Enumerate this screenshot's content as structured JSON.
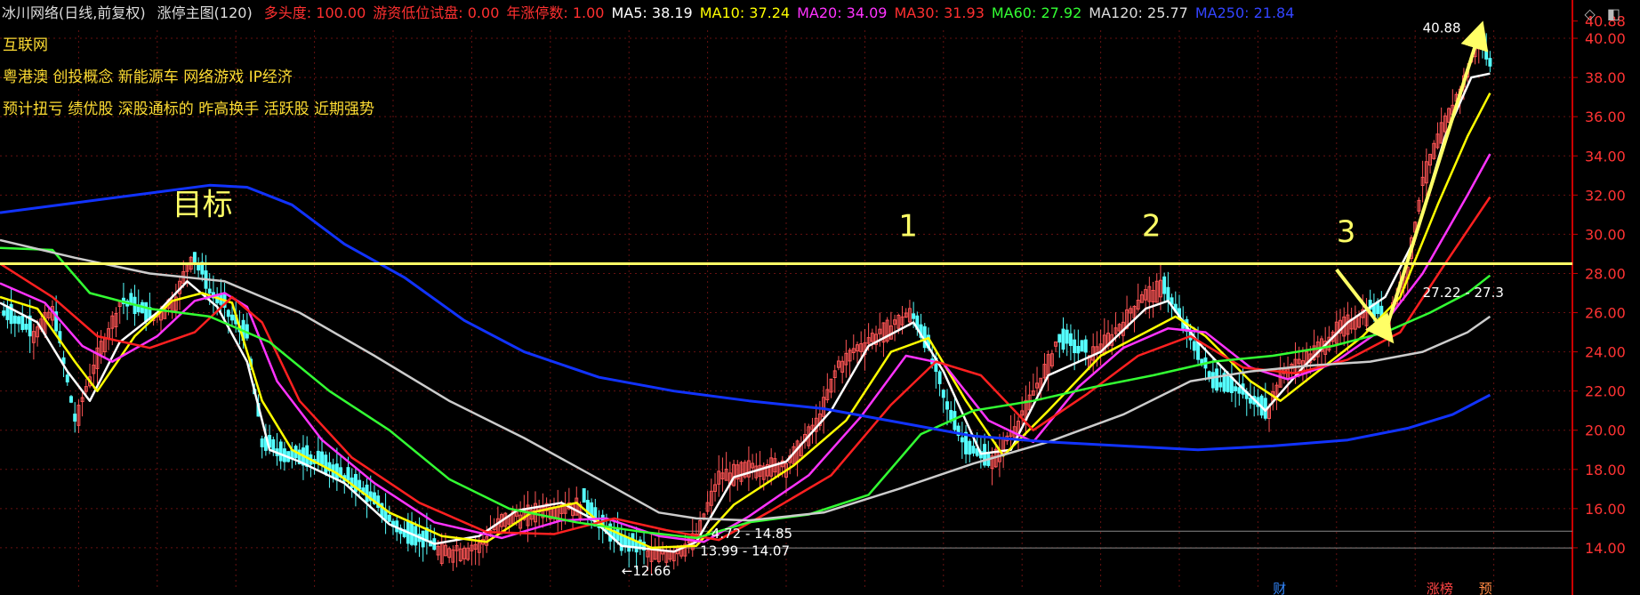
{
  "header": {
    "title": "冰川网络(日线,前复权)",
    "main_chart_label": "涨停主图(120)",
    "indicators": [
      {
        "label": "多头度: 100.00",
        "color": "#ff3030"
      },
      {
        "label": "游资低位试盘: 0.00",
        "color": "#ff3030"
      },
      {
        "label": "年涨停数: 1.00",
        "color": "#ff3030"
      },
      {
        "label": "MA5: 38.19",
        "color": "#ffffff"
      },
      {
        "label": "MA10: 37.24",
        "color": "#ffff00"
      },
      {
        "label": "MA20: 34.09",
        "color": "#ff33ff"
      },
      {
        "label": "MA30: 31.93",
        "color": "#ff3030"
      },
      {
        "label": "MA60: 27.92",
        "color": "#33ff33"
      },
      {
        "label": "MA120: 25.77",
        "color": "#dddddd"
      },
      {
        "label": "MA250: 21.84",
        "color": "#3344ff"
      }
    ]
  },
  "concepts": {
    "line1": "互联网",
    "line2": "粤港澳 创投概念 新能源车 网络游戏 IP经济",
    "line3": "预计扭亏 绩优股 深股通标的 昨高换手 活跃股 近期强势"
  },
  "icons": {
    "diamond": "diamond-icon",
    "window": "window-icon"
  },
  "chart_data": {
    "type": "candlestick",
    "y_axis_ticks": [
      "40.88",
      "40.00",
      "38.00",
      "36.00",
      "34.00",
      "32.00",
      "30.00",
      "28.00",
      "26.00",
      "24.00",
      "22.00",
      "20.00",
      "18.00",
      "16.00",
      "14.00"
    ],
    "ylim": [
      12.0,
      41.5
    ],
    "x_range": [
      0,
      420
    ],
    "colors": {
      "up": "#ff5555",
      "down": "#55ffff",
      "bg": "#000000",
      "axis": "#cc0000",
      "grid": "#661111"
    },
    "horizontal_line": {
      "y": 28.5,
      "color": "#ffff66"
    },
    "gray_lines": [
      14.85,
      13.99
    ],
    "annotations": [
      {
        "text": "目标",
        "x": 46,
        "y": 31.0,
        "color": "#ffff66"
      },
      {
        "text": "1",
        "x": 240,
        "y": 29.9,
        "color": "#ffff66"
      },
      {
        "text": "2",
        "x": 305,
        "y": 29.9,
        "color": "#ffff66"
      },
      {
        "text": "3",
        "x": 357,
        "y": 29.6,
        "color": "#ffff66"
      },
      {
        "text": "40.88",
        "x": 380,
        "y": 40.3,
        "color": "#ffffff"
      },
      {
        "text": "27.22 - 27.3",
        "x": 380,
        "y": 26.8,
        "color": "#ffffff"
      },
      {
        "text": "4.72 - 14.85",
        "x": 190,
        "y": 14.5,
        "color": "#ffffff"
      },
      {
        "text": "13.99 - 14.07",
        "x": 187,
        "y": 13.6,
        "color": "#ffffff"
      },
      {
        "text": "←12.66",
        "x": 166,
        "y": 12.6,
        "color": "#ffffff"
      }
    ],
    "yellow_arrows": [
      {
        "x1": 357,
        "y1": 28.2,
        "x2": 370,
        "y2": 25.0
      },
      {
        "x1": 370,
        "y1": 25.0,
        "x2": 395,
        "y2": 40.2
      }
    ],
    "bottom_tags": [
      {
        "text": "财",
        "x": 340,
        "color": "#3388ff"
      },
      {
        "text": "涨榜",
        "x": 381,
        "color": "#ff4444"
      },
      {
        "text": "预",
        "x": 395,
        "color": "#ff8844"
      }
    ],
    "candle_path": [
      [
        0,
        26.0
      ],
      [
        8,
        25.0
      ],
      [
        14,
        26.2
      ],
      [
        20,
        20.5
      ],
      [
        26,
        24.0
      ],
      [
        32,
        26.6
      ],
      [
        40,
        25.6
      ],
      [
        47,
        27.0
      ],
      [
        51,
        29.0
      ],
      [
        56,
        27.0
      ],
      [
        62,
        25.6
      ],
      [
        66,
        24.5
      ],
      [
        70,
        19.2
      ],
      [
        76,
        18.5
      ],
      [
        84,
        18.3
      ],
      [
        96,
        16.9
      ],
      [
        108,
        14.5
      ],
      [
        116,
        14.0
      ],
      [
        128,
        14.2
      ],
      [
        134,
        15.6
      ],
      [
        145,
        16.2
      ],
      [
        155,
        16.4
      ],
      [
        160,
        15.0
      ],
      [
        166,
        14.0
      ],
      [
        172,
        13.8
      ],
      [
        180,
        14.0
      ],
      [
        186,
        14.7
      ],
      [
        192,
        17.8
      ],
      [
        200,
        18.3
      ],
      [
        210,
        18.5
      ],
      [
        218,
        20.5
      ],
      [
        224,
        23.5
      ],
      [
        230,
        24.5
      ],
      [
        236,
        25.3
      ],
      [
        243,
        26.1
      ],
      [
        248,
        24.0
      ],
      [
        253,
        21.0
      ],
      [
        258,
        19.0
      ],
      [
        264,
        18.3
      ],
      [
        270,
        20.0
      ],
      [
        276,
        22.0
      ],
      [
        282,
        24.5
      ],
      [
        290,
        23.8
      ],
      [
        298,
        25.2
      ],
      [
        305,
        27.0
      ],
      [
        310,
        27.5
      ],
      [
        318,
        24.5
      ],
      [
        324,
        22.3
      ],
      [
        330,
        22.0
      ],
      [
        338,
        20.8
      ],
      [
        342,
        23.0
      ],
      [
        350,
        24.0
      ],
      [
        358,
        25.5
      ],
      [
        365,
        26.2
      ],
      [
        370,
        25.5
      ],
      [
        376,
        28.5
      ],
      [
        380,
        33.0
      ],
      [
        385,
        35.5
      ],
      [
        390,
        37.5
      ],
      [
        395,
        40.0
      ],
      [
        398,
        38.5
      ]
    ],
    "series": [
      {
        "name": "MA5",
        "color": "#ffffff",
        "path": [
          [
            0,
            26.5
          ],
          [
            10,
            25.5
          ],
          [
            18,
            23.0
          ],
          [
            24,
            21.5
          ],
          [
            32,
            24.5
          ],
          [
            42,
            26.0
          ],
          [
            50,
            27.6
          ],
          [
            58,
            26.3
          ],
          [
            66,
            23.5
          ],
          [
            72,
            19.0
          ],
          [
            80,
            18.4
          ],
          [
            92,
            17.3
          ],
          [
            104,
            15.2
          ],
          [
            116,
            14.2
          ],
          [
            128,
            14.6
          ],
          [
            138,
            15.9
          ],
          [
            150,
            16.3
          ],
          [
            158,
            15.5
          ],
          [
            166,
            14.1
          ],
          [
            180,
            13.8
          ],
          [
            186,
            14.3
          ],
          [
            196,
            17.6
          ],
          [
            210,
            18.4
          ],
          [
            222,
            21.0
          ],
          [
            232,
            24.3
          ],
          [
            244,
            25.5
          ],
          [
            252,
            23.0
          ],
          [
            262,
            18.8
          ],
          [
            270,
            19.0
          ],
          [
            280,
            22.8
          ],
          [
            294,
            24.0
          ],
          [
            306,
            26.2
          ],
          [
            312,
            26.6
          ],
          [
            320,
            24.5
          ],
          [
            330,
            22.5
          ],
          [
            338,
            21.0
          ],
          [
            348,
            23.2
          ],
          [
            360,
            25.5
          ],
          [
            370,
            26.8
          ],
          [
            378,
            29.8
          ],
          [
            386,
            35.0
          ],
          [
            393,
            38.0
          ],
          [
            398,
            38.2
          ]
        ]
      },
      {
        "name": "MA10",
        "color": "#ffff00",
        "path": [
          [
            0,
            26.8
          ],
          [
            10,
            26.2
          ],
          [
            20,
            23.5
          ],
          [
            26,
            22.0
          ],
          [
            36,
            24.8
          ],
          [
            46,
            26.6
          ],
          [
            54,
            27.0
          ],
          [
            62,
            26.5
          ],
          [
            70,
            21.5
          ],
          [
            78,
            19.0
          ],
          [
            90,
            17.8
          ],
          [
            104,
            15.8
          ],
          [
            118,
            14.6
          ],
          [
            130,
            14.3
          ],
          [
            142,
            15.8
          ],
          [
            154,
            16.3
          ],
          [
            162,
            15.0
          ],
          [
            174,
            14.0
          ],
          [
            186,
            14.1
          ],
          [
            196,
            16.2
          ],
          [
            212,
            18.2
          ],
          [
            226,
            20.5
          ],
          [
            238,
            24.0
          ],
          [
            248,
            24.7
          ],
          [
            258,
            21.5
          ],
          [
            268,
            18.7
          ],
          [
            280,
            21.0
          ],
          [
            294,
            23.8
          ],
          [
            306,
            25.0
          ],
          [
            314,
            25.8
          ],
          [
            322,
            24.8
          ],
          [
            334,
            22.5
          ],
          [
            342,
            21.5
          ],
          [
            352,
            23.0
          ],
          [
            364,
            24.8
          ],
          [
            374,
            26.8
          ],
          [
            384,
            31.5
          ],
          [
            392,
            35.0
          ],
          [
            398,
            37.2
          ]
        ]
      },
      {
        "name": "MA20",
        "color": "#ff33ff",
        "path": [
          [
            0,
            27.5
          ],
          [
            12,
            26.5
          ],
          [
            22,
            24.3
          ],
          [
            30,
            23.5
          ],
          [
            42,
            24.8
          ],
          [
            52,
            26.6
          ],
          [
            60,
            27.0
          ],
          [
            66,
            26.3
          ],
          [
            74,
            22.5
          ],
          [
            86,
            19.5
          ],
          [
            100,
            17.3
          ],
          [
            116,
            15.3
          ],
          [
            134,
            14.5
          ],
          [
            150,
            15.4
          ],
          [
            162,
            15.5
          ],
          [
            176,
            14.6
          ],
          [
            188,
            14.3
          ],
          [
            200,
            15.6
          ],
          [
            216,
            17.7
          ],
          [
            230,
            20.7
          ],
          [
            242,
            23.8
          ],
          [
            252,
            23.4
          ],
          [
            264,
            20.5
          ],
          [
            276,
            19.4
          ],
          [
            288,
            22.2
          ],
          [
            300,
            24.2
          ],
          [
            312,
            25.2
          ],
          [
            322,
            25.0
          ],
          [
            334,
            23.2
          ],
          [
            344,
            22.6
          ],
          [
            356,
            23.4
          ],
          [
            368,
            25.0
          ],
          [
            380,
            28.0
          ],
          [
            392,
            32.0
          ],
          [
            398,
            34.1
          ]
        ]
      },
      {
        "name": "MA30",
        "color": "#ff2020",
        "path": [
          [
            0,
            28.5
          ],
          [
            14,
            26.8
          ],
          [
            26,
            24.8
          ],
          [
            40,
            24.2
          ],
          [
            52,
            25.0
          ],
          [
            62,
            26.8
          ],
          [
            70,
            25.5
          ],
          [
            80,
            21.5
          ],
          [
            94,
            18.6
          ],
          [
            112,
            16.3
          ],
          [
            130,
            14.8
          ],
          [
            148,
            14.7
          ],
          [
            164,
            15.5
          ],
          [
            178,
            14.9
          ],
          [
            192,
            14.4
          ],
          [
            206,
            15.9
          ],
          [
            222,
            17.7
          ],
          [
            238,
            21.3
          ],
          [
            250,
            23.5
          ],
          [
            262,
            22.8
          ],
          [
            276,
            20.0
          ],
          [
            290,
            21.8
          ],
          [
            304,
            23.8
          ],
          [
            318,
            24.8
          ],
          [
            332,
            23.2
          ],
          [
            346,
            22.9
          ],
          [
            360,
            23.6
          ],
          [
            374,
            25.0
          ],
          [
            386,
            28.5
          ],
          [
            398,
            31.9
          ]
        ]
      },
      {
        "name": "MA60",
        "color": "#33ff33",
        "path": [
          [
            0,
            29.3
          ],
          [
            14,
            29.2
          ],
          [
            24,
            27.0
          ],
          [
            40,
            26.2
          ],
          [
            56,
            25.8
          ],
          [
            72,
            24.5
          ],
          [
            88,
            22.0
          ],
          [
            104,
            20.0
          ],
          [
            120,
            17.5
          ],
          [
            136,
            16.0
          ],
          [
            154,
            15.3
          ],
          [
            172,
            14.8
          ],
          [
            186,
            14.5
          ],
          [
            200,
            15.3
          ],
          [
            216,
            15.7
          ],
          [
            232,
            16.7
          ],
          [
            246,
            19.8
          ],
          [
            260,
            21.0
          ],
          [
            276,
            21.5
          ],
          [
            292,
            22.2
          ],
          [
            308,
            22.8
          ],
          [
            324,
            23.5
          ],
          [
            340,
            23.8
          ],
          [
            356,
            24.3
          ],
          [
            370,
            25.0
          ],
          [
            382,
            26.0
          ],
          [
            392,
            27.0
          ],
          [
            398,
            27.9
          ]
        ]
      },
      {
        "name": "MA120",
        "color": "#cccccc",
        "path": [
          [
            0,
            29.7
          ],
          [
            20,
            28.8
          ],
          [
            40,
            28.0
          ],
          [
            60,
            27.6
          ],
          [
            80,
            26.0
          ],
          [
            100,
            23.8
          ],
          [
            120,
            21.5
          ],
          [
            140,
            19.6
          ],
          [
            160,
            17.5
          ],
          [
            176,
            15.8
          ],
          [
            186,
            15.5
          ],
          [
            200,
            15.4
          ],
          [
            220,
            15.8
          ],
          [
            240,
            17.0
          ],
          [
            260,
            18.3
          ],
          [
            280,
            19.4
          ],
          [
            300,
            20.8
          ],
          [
            318,
            22.5
          ],
          [
            334,
            23.0
          ],
          [
            350,
            23.3
          ],
          [
            366,
            23.5
          ],
          [
            380,
            24.0
          ],
          [
            392,
            25.0
          ],
          [
            398,
            25.8
          ]
        ]
      },
      {
        "name": "MA250",
        "color": "#1133ff",
        "path": [
          [
            0,
            31.1
          ],
          [
            20,
            31.6
          ],
          [
            40,
            32.1
          ],
          [
            56,
            32.5
          ],
          [
            66,
            32.4
          ],
          [
            78,
            31.5
          ],
          [
            92,
            29.5
          ],
          [
            108,
            27.8
          ],
          [
            124,
            25.6
          ],
          [
            140,
            24.0
          ],
          [
            160,
            22.7
          ],
          [
            180,
            22.0
          ],
          [
            200,
            21.5
          ],
          [
            220,
            21.1
          ],
          [
            240,
            20.4
          ],
          [
            260,
            19.7
          ],
          [
            280,
            19.4
          ],
          [
            300,
            19.2
          ],
          [
            320,
            19.0
          ],
          [
            340,
            19.2
          ],
          [
            360,
            19.5
          ],
          [
            376,
            20.1
          ],
          [
            388,
            20.8
          ],
          [
            398,
            21.8
          ]
        ]
      }
    ]
  }
}
